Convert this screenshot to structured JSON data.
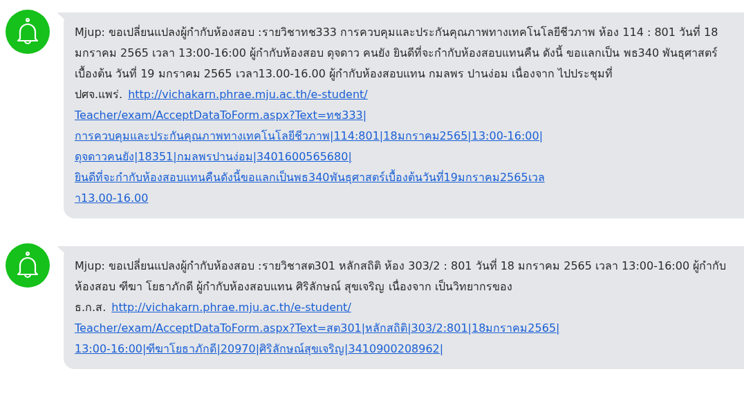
{
  "messages": [
    {
      "text": "Mjup: ขอเปลี่ยนแปลงผู้กำกับห้องสอบ :รายวิชาทช333 การควบคุมและประกันคุณภาพทางเทคโนโลยีชีวภาพ ห้อง 114 : 801 วันที่  18 มกราคม 2565 เวลา 13:00-16:00 ผู้กำกับห้องสอบ ดุจดาว คนยัง ยินดีที่จะกำกับห้องสอบแทนคืน ดังนี้ ขอแลกเป็น พธ340 พันธุศาสตร์เบื้องต้น วันที่ 19 มกราคม 2565 เวลา13.00-16.00 ผู้กำกับห้องสอบแทน กมลพร  ปานง่อม เนื่องจาก ไปประชุมที่ ปศจ.แพร่.",
      "link_lines": [
        "http://vichakarn.phrae.mju.ac.th/e-student/",
        "Teacher/exam/AcceptDataToForm.aspx?Text=ทช333|",
        "การควบคุมและประกันคุณภาพทางเทคโนโลยีชีวภาพ|114:801|18มกราคม2565|13:00-16:00|",
        "ดุจดาวคนยัง|18351|กมลพรปานง่อม|3401600565680|",
        "ยินดีที่จะกำกับห้องสอบแทนคืนดังนี้ขอแลกเป็นพธ340พันธุศาสตร์เบื้องต้นวันที่19มกราคม2565เวล",
        "า13.00-16.00"
      ]
    },
    {
      "text": "Mjup: ขอเปลี่ยนแปลงผู้กำกับห้องสอบ :รายวิชาสต301 หลักสถิติ ห้อง 303/2 : 801 วันที่  18 มกราคม 2565 เวลา 13:00-16:00 ผู้กำกับห้องสอบ ฑีฆา โยธาภักดี ผู้กำกับห้องสอบแทน ศิริลักษณ์ สุขเจริญ เนื่องจาก เป็นวิทยากรของธ.ก.ส.",
      "link_lines": [
        "http://vichakarn.phrae.mju.ac.th/e-student/",
        "Teacher/exam/AcceptDataToForm.aspx?Text=สต301|หลักสถิติ|303/2:801|18มกราคม2565|",
        "13:00-16:00|ฑีฆาโยธาภักดี|20970|ศิริลักษณ์สุขเจริญ|3410900208962|"
      ]
    }
  ]
}
